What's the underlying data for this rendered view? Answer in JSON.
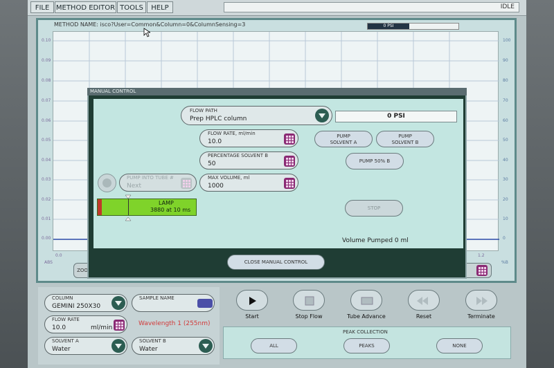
{
  "menu": {
    "file": "FILE",
    "method_editor": "METHOD EDITOR",
    "tools": "TOOLS",
    "help": "HELP",
    "status": "IDLE"
  },
  "method": {
    "name": "METHOD NAME: isco?User=Common&Column=0&ColumnSensing=3",
    "psi_bar": "0 PSI"
  },
  "plot": {
    "left_ticks": [
      "0.10",
      "0.09",
      "0.08",
      "0.07",
      "0.06",
      "0.05",
      "0.04",
      "0.03",
      "0.02",
      "0.01",
      "0.00"
    ],
    "right_ticks": [
      "100",
      "90",
      "80",
      "70",
      "60",
      "50",
      "40",
      "30",
      "20",
      "10",
      "0"
    ],
    "abs_label": "ABS",
    "pct_label": "%B",
    "x_start": "0.0",
    "x_end": "1.2",
    "zoom_partial": "ZOO",
    "in_partial": "IN",
    "h_partial": "H",
    "n_partial": "n."
  },
  "manual_control": {
    "title": "MANUAL CONTROL",
    "flow_path_label": "FLOW PATH",
    "flow_path_value": "Prep HPLC column",
    "psi_value": "0 PSI",
    "flow_rate_label": "FLOW RATE, ml/min",
    "flow_rate_value": "10.0",
    "solvent_b_label": "PERCENTAGE SOLVENT B",
    "solvent_b_value": "50",
    "max_volume_label": "MAX VOLUME, ml",
    "max_volume_value": "1000",
    "pump_into_tube_label": "PUMP INTO TUBE #",
    "pump_into_tube_value": "Next",
    "pump_a": "PUMP\nSOLVENT A",
    "pump_b": "PUMP\nSOLVENT B",
    "pump_50": "PUMP 50% B",
    "stop": "STOP",
    "lamp_title": "LAMP",
    "lamp_value": "3880 at 10 ms",
    "volume_pumped": "Volume Pumped 0 ml",
    "close": "CLOSE MANUAL CONTROL"
  },
  "bottom": {
    "column_label": "COLUMN",
    "column_value": "GEMINI 250X30",
    "sample_name_label": "SAMPLE NAME",
    "sample_name_value": "",
    "flow_rate_label": "FLOW RATE",
    "flow_rate_value": "10.0",
    "flow_rate_unit": "ml/min",
    "wavelength": "Wavelength 1 (255nm)",
    "solvent_a_label": "SOLVENT A",
    "solvent_a_value": "Water",
    "solvent_b_label": "SOLVENT B",
    "solvent_b_value": "Water"
  },
  "transport": {
    "start": "Start",
    "stop_flow": "Stop Flow",
    "tube_advance": "Tube Advance",
    "reset": "Reset",
    "terminate": "Terminate"
  },
  "peak_collection": {
    "title": "PEAK COLLECTION",
    "all": "ALL",
    "peaks": "PEAKS",
    "none": "NONE"
  },
  "colors": {
    "lamp_green": "#7fd32a",
    "lamp_red": "#c0392b",
    "wavelength_red": "#d23a3a",
    "keypad": "#8a2a74"
  }
}
